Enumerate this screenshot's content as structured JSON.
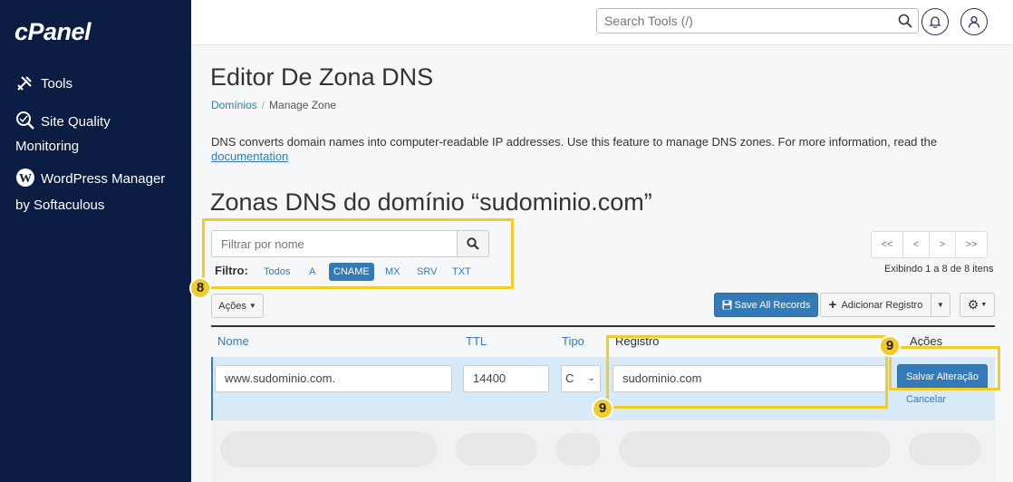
{
  "sidebar": {
    "logo": "cPanel",
    "items": [
      {
        "label": "Tools",
        "icon": "tools-icon"
      },
      {
        "label": "Site Quality",
        "label2": "Monitoring",
        "icon": "site-quality-icon"
      },
      {
        "label": "WordPress Manager",
        "label2": "by Softaculous",
        "icon": "wordpress-icon"
      }
    ]
  },
  "header": {
    "search_placeholder": "Search Tools (/)"
  },
  "page": {
    "title": "Editor De Zona DNS",
    "breadcrumb": [
      "Domínios",
      "Manage Zone"
    ],
    "description": "DNS converts domain names into computer-readable IP addresses. Use this feature to manage DNS zones. For more information, read the",
    "description_link": "documentation",
    "zone_title": "Zonas DNS do domínio “sudominio.com”"
  },
  "filter": {
    "placeholder": "Filtrar por nome",
    "label": "Filtro:",
    "types": [
      "Todos",
      "A",
      "CNAME",
      "MX",
      "SRV",
      "TXT"
    ],
    "active": "CNAME"
  },
  "pager": {
    "buttons": [
      "<<",
      "<",
      ">",
      ">>"
    ],
    "showing": "Exibindo 1 a 8 de 8 itens"
  },
  "toolbar": {
    "actions": "Ações",
    "save_all": "Save All Records",
    "add_record": "Adicionar Registro"
  },
  "table": {
    "headers": {
      "name": "Nome",
      "ttl": "TTL",
      "type": "Tipo",
      "record": "Registro",
      "actions": "Ações"
    },
    "edit_row": {
      "name": "www.sudominio.com.",
      "ttl": "14400",
      "type": "C",
      "record": "sudominio.com",
      "save": "Salvar Alteração",
      "cancel": "Cancelar"
    }
  },
  "annotations": {
    "badge_filter": "8",
    "badge_record": "9",
    "badge_save": "9"
  },
  "colors": {
    "sidebar": "#0c1d44",
    "accent": "#337ab7",
    "highlight": "#f2cd2a"
  }
}
